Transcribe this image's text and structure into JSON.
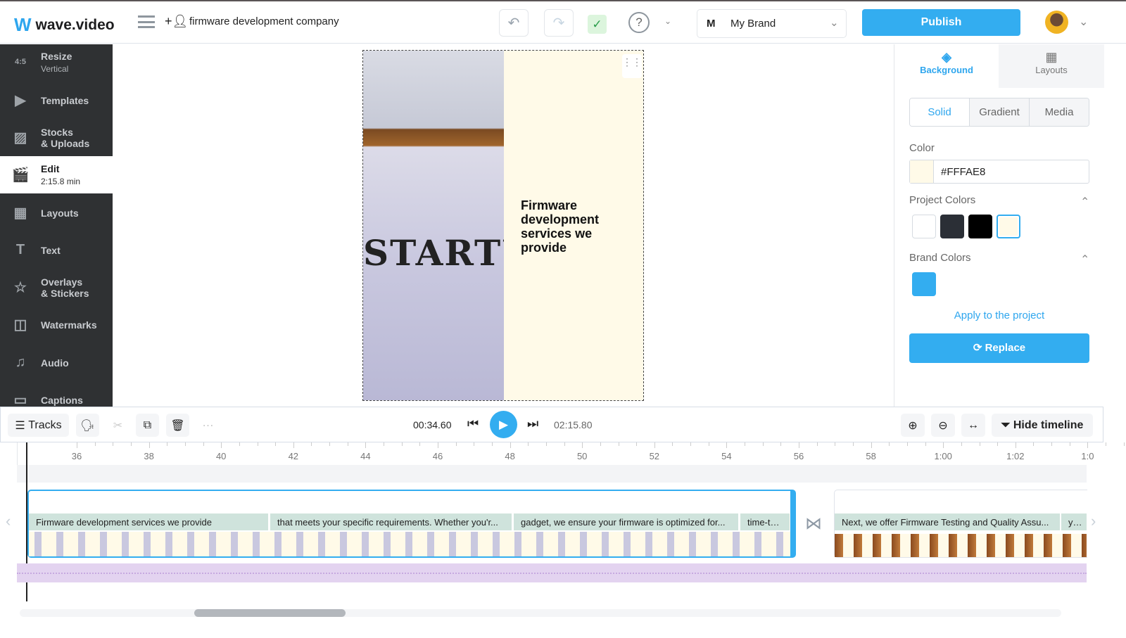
{
  "header": {
    "logo": "wave.video",
    "project_name": "firmware development company",
    "brand_initial": "M",
    "brand_name": "My Brand",
    "publish_label": "Publish",
    "colors": {
      "accent": "#33adf0",
      "saved": "#2a9d4a"
    }
  },
  "sidebar": {
    "items": [
      {
        "label": "Resize",
        "sub": "Vertical",
        "icon": "aspect-ratio-icon",
        "glyph": "4:5"
      },
      {
        "label": "Templates",
        "icon": "templates-icon",
        "glyph": "▶"
      },
      {
        "label": "Stocks",
        "label2": "& Uploads",
        "icon": "image-icon",
        "glyph": "▨"
      },
      {
        "label": "Edit",
        "sub": "2:15.8 min",
        "icon": "clapperboard-icon",
        "glyph": "🎬",
        "active": true
      },
      {
        "label": "Layouts",
        "icon": "layouts-icon",
        "glyph": "▦"
      },
      {
        "label": "Text",
        "icon": "text-icon",
        "glyph": "T"
      },
      {
        "label": "Overlays",
        "label2": "& Stickers",
        "icon": "star-icon",
        "glyph": "☆"
      },
      {
        "label": "Watermarks",
        "icon": "watermark-icon",
        "glyph": "◫"
      },
      {
        "label": "Audio",
        "icon": "music-icon",
        "glyph": "♫"
      },
      {
        "label": "Captions",
        "icon": "captions-icon",
        "glyph": "▭"
      }
    ]
  },
  "preview": {
    "headline": "Firmware development services we provide",
    "photo_text": "STARTU"
  },
  "right_panel": {
    "tabs": [
      "Background",
      "Layouts"
    ],
    "modes": [
      "Solid",
      "Gradient",
      "Media"
    ],
    "color_label": "Color",
    "color_value": "#FFFAE8",
    "project_colors_label": "Project Colors",
    "project_colors": [
      "#ffffff",
      "#2b2f36",
      "#000000",
      "#fffae8"
    ],
    "brand_colors_label": "Brand Colors",
    "brand_colors": [
      "#33adf0"
    ],
    "apply_label": "Apply to the project",
    "replace_label": "Replace"
  },
  "timeline": {
    "tracks_label": "Tracks",
    "current_time": "00:34.60",
    "total_time": "02:15.80",
    "hide_label": "Hide timeline",
    "ruler": [
      "36",
      "38",
      "40",
      "42",
      "44",
      "46",
      "48",
      "50",
      "52",
      "54",
      "56",
      "58",
      "1:00",
      "1:02",
      "1:0"
    ],
    "captions": [
      "Firmware development services we provide",
      "that meets your specific requirements. Whether you'r...",
      "gadget, we ensure your firmware is optimized for...",
      "time-to-...",
      "Next, we offer Firmware Testing and Quality Assu...",
      "your"
    ]
  }
}
